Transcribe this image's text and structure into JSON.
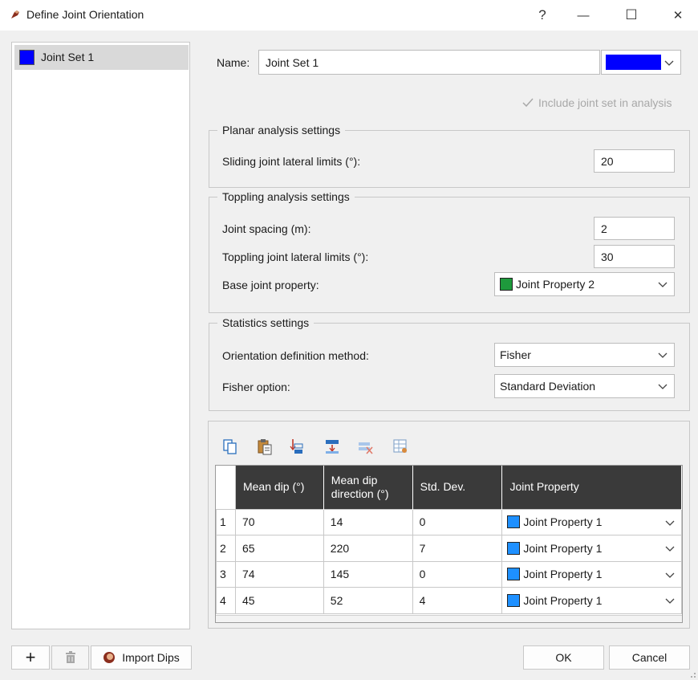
{
  "window": {
    "title": "Define Joint Orientation",
    "help_glyph": "?",
    "minimize_glyph": "—",
    "maximize_glyph": "☐",
    "close_glyph": "✕"
  },
  "joint_sets": [
    {
      "label": "Joint Set 1",
      "color": "#0000ff"
    }
  ],
  "form": {
    "name_label": "Name:",
    "name_value": "Joint Set 1",
    "name_color": "#0000ff",
    "include_label": "Include joint set in analysis",
    "include_checked": true
  },
  "planar": {
    "title": "Planar analysis settings",
    "sliding_label": "Sliding joint lateral limits (°):",
    "sliding_value": "20"
  },
  "toppling": {
    "title": "Toppling analysis settings",
    "spacing_label": "Joint spacing (m):",
    "spacing_value": "2",
    "lateral_label": "Toppling joint lateral limits (°):",
    "lateral_value": "30",
    "base_label": "Base joint property:",
    "base_value": "Joint Property 2",
    "base_color": "#1e9a3c"
  },
  "statistics": {
    "title": "Statistics settings",
    "method_label": "Orientation definition method:",
    "method_value": "Fisher",
    "option_label": "Fisher option:",
    "option_value": "Standard Deviation"
  },
  "toolbar_icons": [
    "copy-icon",
    "paste-icon",
    "insert-row-icon",
    "append-row-icon",
    "delete-row-icon",
    "table-properties-icon"
  ],
  "table": {
    "headers": [
      "Mean dip (°)",
      "Mean dip\ndirection (°)",
      "Std. Dev.",
      "Joint Property"
    ],
    "rows": [
      {
        "index": "1",
        "dip": "70",
        "dir": "14",
        "std": "0",
        "prop": "Joint Property 1"
      },
      {
        "index": "2",
        "dip": "65",
        "dir": "220",
        "std": "7",
        "prop": "Joint Property 1"
      },
      {
        "index": "3",
        "dip": "74",
        "dir": "145",
        "std": "0",
        "prop": "Joint Property 1"
      },
      {
        "index": "4",
        "dip": "45",
        "dir": "52",
        "std": "4",
        "prop": "Joint Property 1"
      }
    ],
    "prop_color": "#1e90ff"
  },
  "bottom": {
    "add_glyph": "+",
    "import_label": "Import Dips",
    "ok_label": "OK",
    "cancel_label": "Cancel"
  }
}
